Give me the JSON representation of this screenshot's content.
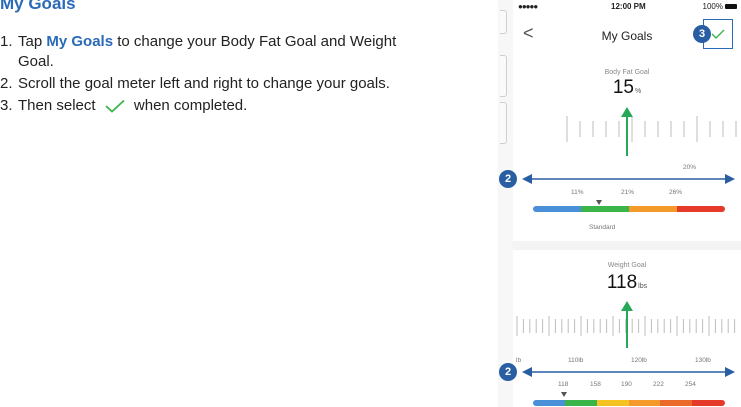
{
  "instructions": {
    "heading": "My Goals",
    "steps": [
      {
        "num": "1.",
        "pre": "Tap ",
        "bold": "My Goals",
        "post": " to change your Body Fat Goal and Weight Goal."
      },
      {
        "num": "2.",
        "text": "Scroll the goal meter left and right to change your goals."
      },
      {
        "num": "3.",
        "pre": "Then select",
        "post": "when completed."
      }
    ]
  },
  "phone": {
    "status": {
      "signal": "●●●●● ",
      "time": "12:00 PM",
      "battery": "100%"
    },
    "nav": {
      "back": "<",
      "title": "My Goals",
      "confirm_icon": "checkmark-icon"
    },
    "body_fat": {
      "label": "Body Fat Goal",
      "value": "15",
      "unit": "%",
      "ruler_label": "20%",
      "range_labels": [
        "11%",
        "21%",
        "26%"
      ],
      "category": "Standard"
    },
    "weight": {
      "label": "Weight Goal",
      "value": "118",
      "unit": "lbs",
      "ruler_labels": [
        "lb",
        "110lb",
        "120lb",
        "130lb"
      ],
      "range_labels": [
        "118",
        "158",
        "190",
        "222",
        "254"
      ]
    }
  },
  "annotations": {
    "badge_scroll": "2",
    "badge_confirm": "3"
  },
  "colors": {
    "accent": "#2a6ab7",
    "arrow": "#2a5ea3",
    "check": "#3cb54a",
    "indicator": "#27a857",
    "bar_blue": "#4a90d9",
    "bar_green": "#3bb54a",
    "bar_yellow": "#f5c321",
    "bar_orange": "#f39a2b",
    "bar_deep_orange": "#ea6a2b",
    "bar_red": "#e53a2a"
  }
}
